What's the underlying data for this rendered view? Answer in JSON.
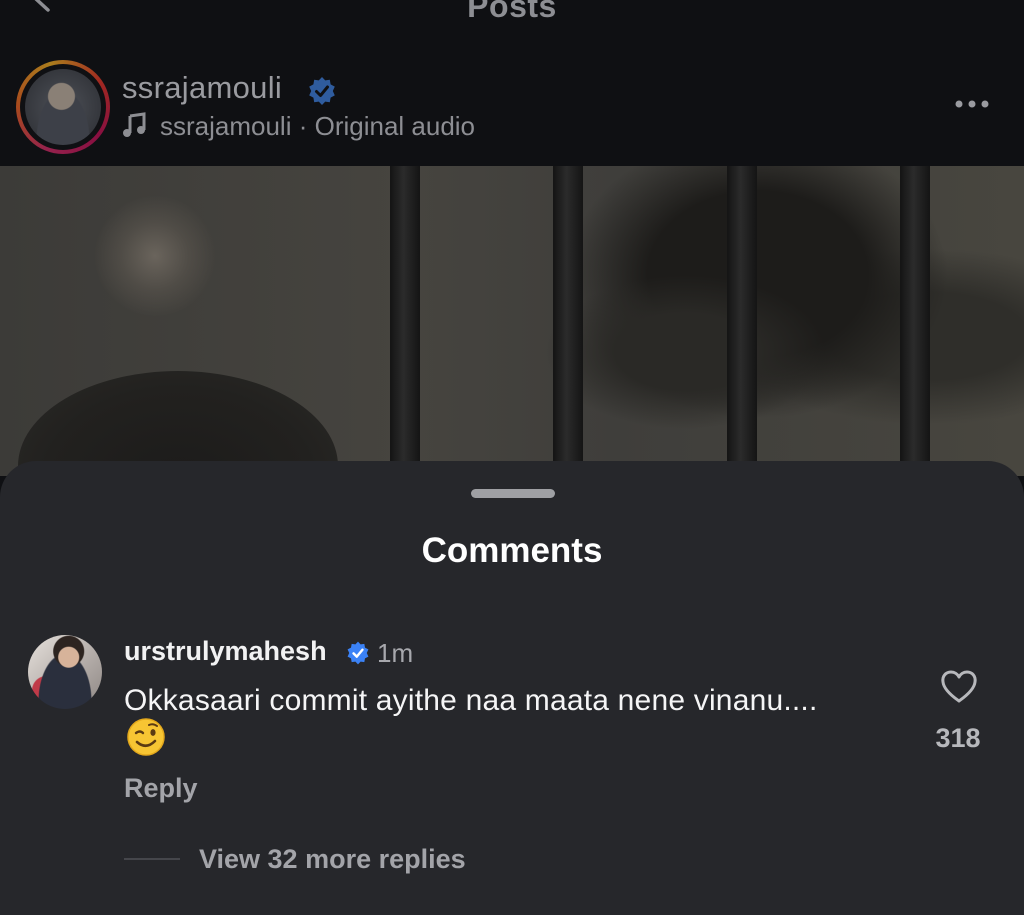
{
  "nav": {
    "title": "Posts",
    "back_icon": "chevron-left-icon"
  },
  "post": {
    "author": "ssrajamouli",
    "audio": "ssrajamouli · Original audio",
    "verified_icon": "verified-badge-icon",
    "music_icon": "music-note-icon",
    "more_icon": "more-horizontal-icon"
  },
  "sheet": {
    "title": "Comments"
  },
  "comment": {
    "username": "urstrulymahesh",
    "time": "1m",
    "text": "Okkasaari commit ayithe naa maata nene vinanu....",
    "emoji": "winking-face-emoji",
    "reply_label": "Reply",
    "likes": "318",
    "like_icon": "heart-outline-icon",
    "view_replies": "View 32 more replies"
  },
  "colors": {
    "background": "#0f1013",
    "sheet": "#26272b",
    "verified": "#3b82f6",
    "text_muted": "#a3a4a9"
  }
}
